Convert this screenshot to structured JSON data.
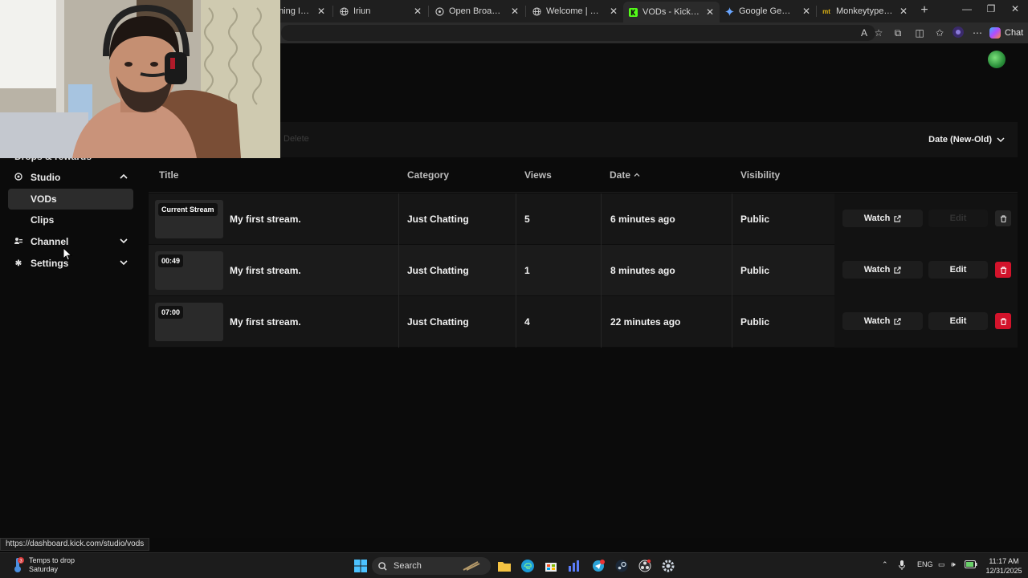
{
  "browser": {
    "tabs": [
      {
        "title": "ming Income",
        "favicon": "money-icon"
      },
      {
        "title": "Iriun",
        "favicon": "globe-icon"
      },
      {
        "title": "Open Broadcaster Softw",
        "favicon": "obs-icon"
      },
      {
        "title": "Welcome | OBS",
        "favicon": "globe-icon"
      },
      {
        "title": "VODs - Kick Dashboard",
        "favicon": "kick-icon",
        "active": true
      },
      {
        "title": "Google Gemini",
        "favicon": "gemini-icon"
      },
      {
        "title": "Monkeytype | A minim",
        "favicon": "monkeytype-icon"
      }
    ],
    "copilot_label": "Chat",
    "status_url": "https://dashboard.kick.com/studio/vods"
  },
  "sidebar": {
    "drops_label": "Drops & rewards",
    "studio_label": "Studio",
    "studio_items": [
      {
        "label": "VODs",
        "active": true
      },
      {
        "label": "Clips",
        "active": false
      }
    ],
    "channel_label": "Channel",
    "settings_label": "Settings"
  },
  "filterbar": {
    "ghost_label": "Delete",
    "sort_label": "Date (New-Old)"
  },
  "table": {
    "headers": {
      "title": "Title",
      "category": "Category",
      "views": "Views",
      "date": "Date",
      "visibility": "Visibility"
    },
    "rows": [
      {
        "badge": "Current Stream",
        "title": "My first stream.",
        "category": "Just Chatting",
        "views": "5",
        "date": "6 minutes ago",
        "visibility": "Public",
        "watch": "Watch",
        "edit": "Edit"
      },
      {
        "badge": "00:49",
        "title": "My first stream.",
        "category": "Just Chatting",
        "views": "1",
        "date": "8 minutes ago",
        "visibility": "Public",
        "watch": "Watch",
        "edit": "Edit"
      },
      {
        "badge": "07:00",
        "title": "My first stream.",
        "category": "Just Chatting",
        "views": "4",
        "date": "22 minutes ago",
        "visibility": "Public",
        "watch": "Watch",
        "edit": "Edit"
      }
    ]
  },
  "taskbar": {
    "weather_title": "Temps to drop",
    "weather_sub": "Saturday",
    "weather_badge": "3",
    "search_label": "Search",
    "lang": "ENG",
    "time": "11:17 AM",
    "date": "12/31/2025"
  },
  "colors": {
    "delete_red": "#d3132b",
    "page_bg": "#0b0b0b",
    "row_bg": "#161616"
  }
}
